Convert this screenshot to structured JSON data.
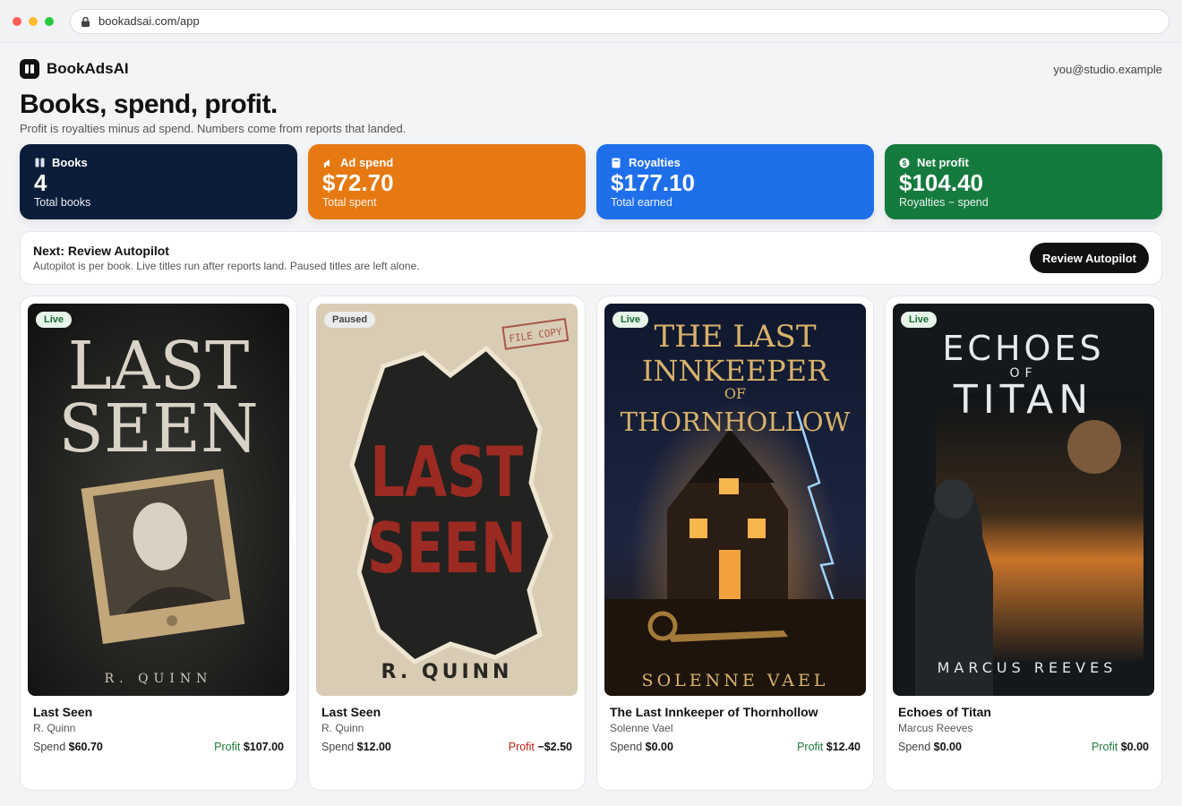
{
  "browser": {
    "url": "bookadsai.com/app"
  },
  "header": {
    "brand": "BookAdsAI",
    "user_email": "you@studio.example"
  },
  "page": {
    "title": "Books, spend, profit.",
    "subtitle": "Profit is royalties minus ad spend. Numbers come from reports that landed."
  },
  "stats": [
    {
      "label": "Books",
      "value": "4",
      "caption": "Total books",
      "color": "#0b1d3a",
      "icon": "book-icon"
    },
    {
      "label": "Ad spend",
      "value": "$72.70",
      "caption": "Total spent",
      "color": "#e67912",
      "icon": "megaphone-icon"
    },
    {
      "label": "Royalties",
      "value": "$177.10",
      "caption": "Total earned",
      "color": "#1f6feb",
      "icon": "receipt-icon"
    },
    {
      "label": "Net profit",
      "value": "$104.40",
      "caption": "Royalties − spend",
      "color": "#157a3e",
      "icon": "coin-icon"
    }
  ],
  "next": {
    "title": "Next: Review Autopilot",
    "description": "Autopilot is per book. Live titles run after reports land. Paused titles are left alone.",
    "button": "Review Autopilot"
  },
  "books": [
    {
      "status": "Live",
      "title": "Last Seen",
      "author": "R. Quinn",
      "spend_label": "Spend",
      "spend": "$60.70",
      "profit_label": "Profit",
      "profit": "$107.00",
      "profit_sign": "positive",
      "cover": {
        "line1": "LAST",
        "line2": "SEEN",
        "author": "R. QUINN"
      }
    },
    {
      "status": "Paused",
      "title": "Last Seen",
      "author": "R. Quinn",
      "spend_label": "Spend",
      "spend": "$12.00",
      "profit_label": "Profit",
      "profit": "−$2.50",
      "profit_sign": "negative",
      "cover": {
        "line1": "LAST",
        "line2": "SEEN",
        "author": "R. QUINN",
        "stamp": "FILE COPY"
      }
    },
    {
      "status": "Live",
      "title": "The Last Innkeeper of Thornhollow",
      "author": "Solenne Vael",
      "spend_label": "Spend",
      "spend": "$0.00",
      "profit_label": "Profit",
      "profit": "$12.40",
      "profit_sign": "positive",
      "cover": {
        "line1": "THE LAST",
        "line2": "INNKEEPER",
        "line3": "OF",
        "line4": "THORNHOLLOW",
        "author": "SOLENNE VAEL"
      }
    },
    {
      "status": "Live",
      "title": "Echoes of Titan",
      "author": "Marcus Reeves",
      "spend_label": "Spend",
      "spend": "$0.00",
      "profit_label": "Profit",
      "profit": "$0.00",
      "profit_sign": "positive",
      "cover": {
        "line1": "ECHOES",
        "line2": "OF",
        "line3": "TITAN",
        "author": "MARCUS REEVES"
      }
    }
  ]
}
